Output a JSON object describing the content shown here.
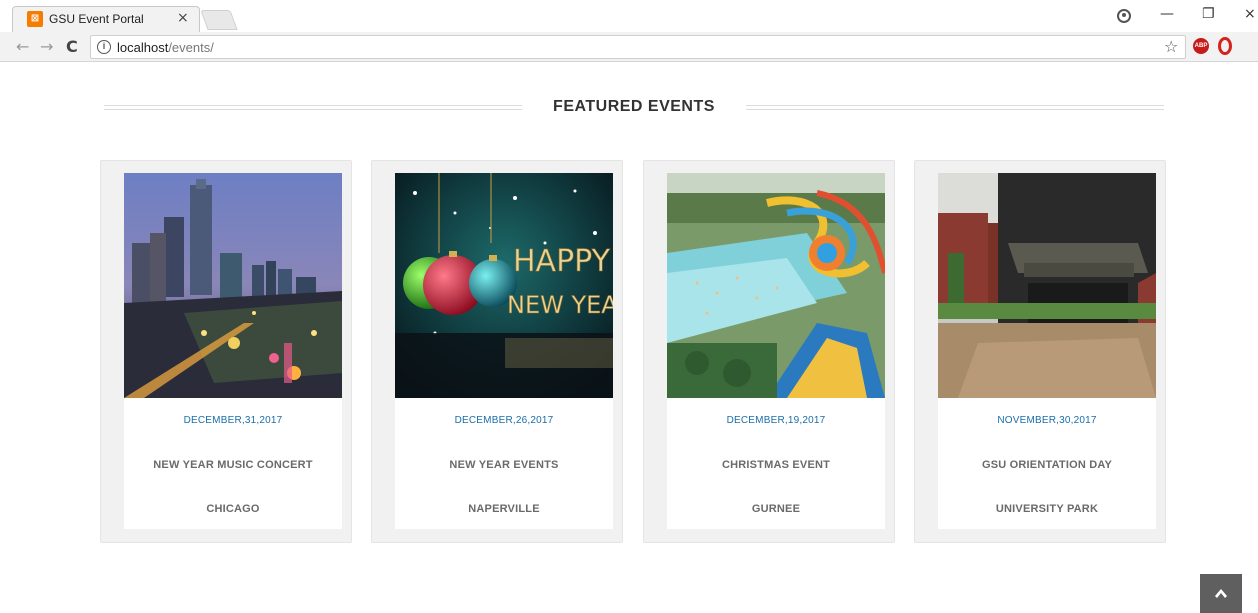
{
  "browser": {
    "tab_title": "GSU Event Portal",
    "tab_close": "×",
    "favicon_glyph": "⊠",
    "url_host": "localhost",
    "url_path": "/events/",
    "abp_label": "ABP",
    "icons": [
      "back-arrow-icon",
      "forward-arrow-icon",
      "reload-icon",
      "info-icon",
      "star-icon",
      "user-icon",
      "adblock-icon",
      "opera-icon"
    ]
  },
  "window": {
    "minimize": "—",
    "restore": "❐",
    "close": "×"
  },
  "featured": {
    "heading": "FEATURED EVENTS"
  },
  "events": [
    {
      "date": "DECEMBER,31,2017",
      "title": "NEW YEAR MUSIC CONCERT",
      "location": "CHICAGO"
    },
    {
      "date": "DECEMBER,26,2017",
      "title": "NEW YEAR EVENTS",
      "location": "NAPERVILLE"
    },
    {
      "date": "DECEMBER,19,2017",
      "title": "CHRISTMAS EVENT",
      "location": "GURNEE"
    },
    {
      "date": "NOVEMBER,30,2017",
      "title": "GSU ORIENTATION DAY",
      "location": "UNIVERSITY PARK"
    }
  ],
  "image_text": {
    "happy": "HAPPY",
    "new_year": "NEW YEAR"
  },
  "colors": {
    "date_link": "#1a6ea8",
    "card_bg": "#f1f1f1",
    "scroll_top_bg": "#5f5f5f"
  }
}
